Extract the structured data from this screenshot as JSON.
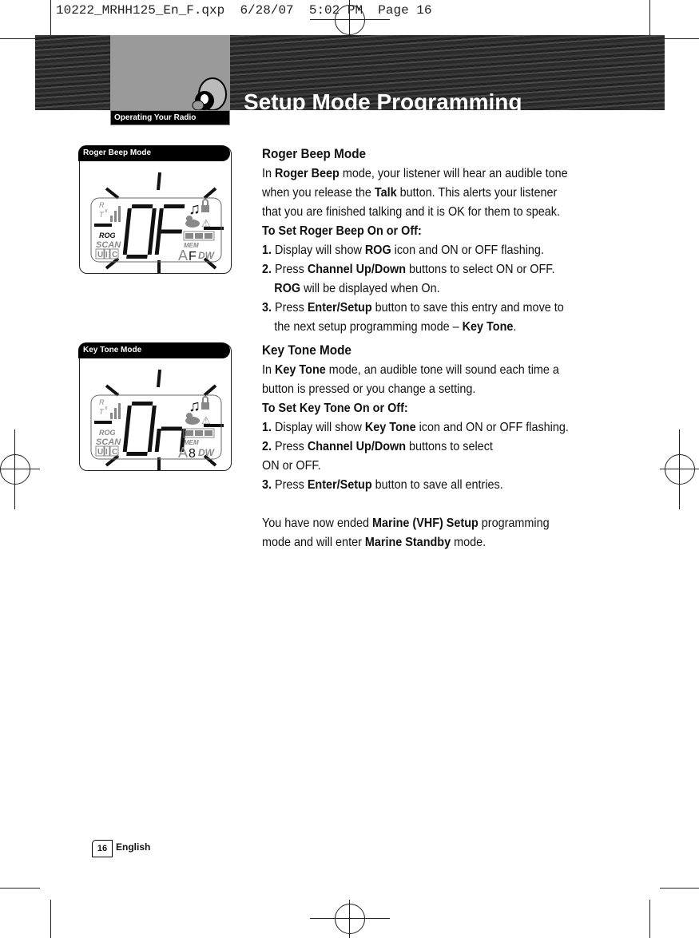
{
  "slug": "10222_MRHH125_En_F.qxp  6/28/07  5:02 PM  Page 16",
  "header": {
    "section_tab": "Operating Your Radio",
    "title": "Setup Mode Programming"
  },
  "panels": [
    {
      "label": "Roger Beep Mode",
      "digits": "OF",
      "sub": "F"
    },
    {
      "label": "Key Tone Mode",
      "digits": "On",
      "sub": "8"
    }
  ],
  "lcd": {
    "rx": "R",
    "tx": "T",
    "x": "x",
    "rog": "ROG",
    "scan": "SCAN",
    "u": "U",
    "i": "I",
    "c": "C",
    "mem": "MEM",
    "a": "A",
    "dw": "DW"
  },
  "sections": [
    {
      "heading": "Roger Beep Mode",
      "paras": [
        {
          "cls": "",
          "runs": [
            [
              "In ",
              0
            ],
            [
              "Roger Beep",
              1
            ],
            [
              " mode, your listener will hear an audible tone when you release the ",
              0
            ],
            [
              "Talk",
              1
            ],
            [
              " button. This alerts your listener that you are finished talking and it is OK for them to speak.",
              0
            ]
          ]
        },
        {
          "cls": "",
          "runs": [
            [
              "To Set Roger Beep On or Off:",
              1
            ]
          ]
        },
        {
          "cls": "ind",
          "runs": [
            [
              "1. ",
              1
            ],
            [
              "Display will show ",
              0
            ],
            [
              "ROG",
              1
            ],
            [
              " icon and ON or OFF flashing.",
              0
            ]
          ]
        },
        {
          "cls": "ind",
          "runs": [
            [
              "2. ",
              1
            ],
            [
              "Press ",
              0
            ],
            [
              "Channel Up/Down",
              1
            ],
            [
              " buttons to select ON or OFF. ",
              0
            ],
            [
              "ROG",
              1
            ],
            [
              " will be displayed when On.",
              0
            ]
          ]
        },
        {
          "cls": "ind",
          "runs": [
            [
              "3. ",
              1
            ],
            [
              "Press ",
              0
            ],
            [
              "Enter/Setup",
              1
            ],
            [
              " button to save this entry and move to the next setup programming mode – ",
              0
            ],
            [
              "Key Tone",
              1
            ],
            [
              ".",
              0
            ]
          ]
        }
      ]
    },
    {
      "heading": "Key Tone Mode",
      "paras": [
        {
          "cls": "",
          "runs": [
            [
              "In ",
              0
            ],
            [
              "Key Tone",
              1
            ],
            [
              " mode, an audible tone will sound each time a button is pressed or you change a setting.",
              0
            ]
          ]
        },
        {
          "cls": "",
          "runs": [
            [
              "To Set Key Tone On or Off:",
              1
            ]
          ]
        },
        {
          "cls": "ind",
          "runs": [
            [
              "1. ",
              1
            ],
            [
              "Display will show ",
              0
            ],
            [
              "Key Tone",
              1
            ],
            [
              " icon and ON or OFF flashing.",
              0
            ]
          ]
        },
        {
          "cls": "ind",
          "runs": [
            [
              "2. ",
              1
            ],
            [
              "Press ",
              0
            ],
            [
              "Channel Up/Down",
              1
            ],
            [
              " buttons to select",
              0
            ]
          ]
        },
        {
          "cls": "ind",
          "runs": [
            [
              "ON or OFF.",
              0
            ]
          ]
        },
        {
          "cls": "ind",
          "runs": [
            [
              "3. ",
              1
            ],
            [
              "Press ",
              0
            ],
            [
              "Enter/Setup",
              1
            ],
            [
              " button to save all entries.",
              0
            ]
          ]
        },
        {
          "cls": "gap",
          "runs": [
            [
              "You have now ended ",
              0
            ],
            [
              "Marine (VHF) Setup",
              1
            ],
            [
              " programming mode and will enter ",
              0
            ],
            [
              "Marine Standby",
              1
            ],
            [
              " mode.",
              0
            ]
          ]
        }
      ]
    }
  ],
  "footer": {
    "page": "16",
    "language": "English"
  }
}
